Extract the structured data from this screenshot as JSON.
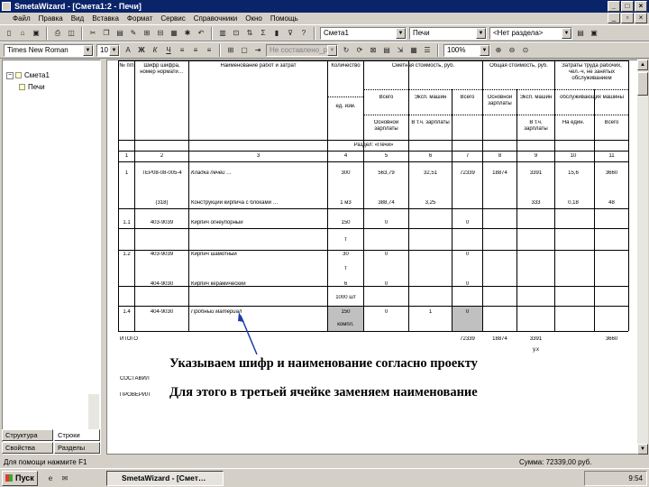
{
  "window": {
    "title": "SmetaWizard - [Смета1:2 - Печи]"
  },
  "menu": [
    "Файл",
    "Правка",
    "Вид",
    "Вставка",
    "Формат",
    "Сервис",
    "Справочники",
    "Окно",
    "Помощь"
  ],
  "toolbar1": {
    "estimate_combo": "Смета1",
    "section_combo": "Печи",
    "subsection_combo": "<Нет раздела>"
  },
  "toolbar2": {
    "font_combo": "Times New Roman",
    "size_combo": "10",
    "style_combo": "Не составлено_раз",
    "zoom_combo": "100%"
  },
  "tree": {
    "root": "Смета1",
    "child": "Печи"
  },
  "panel_tabs": [
    "Структура",
    "Строки",
    "Свойства",
    "Разделы"
  ],
  "table": {
    "header": [
      "№ п/п",
      "Шифр шифра, номер нормати…",
      "Наименование работ и затрат",
      "Количество",
      "Сметная стоимость, руб.",
      "Общая стоимость, руб.",
      "Затраты труда рабочих, чел.-ч, не занятых обслуживанием"
    ],
    "subheader": [
      "Всего",
      "Эксп. машин",
      "Всего",
      "Основной зарплаты",
      "Эксп. машин",
      "обслуживающих машины"
    ],
    "subheader2": [
      "ед. изм.",
      "Основной зарплаты",
      "В т.ч. зарплаты",
      "В т.ч. зарплаты",
      "На един.",
      "Всего"
    ],
    "section": "Раздел: «Печи»",
    "col_numbers": [
      "1",
      "2",
      "3",
      "4",
      "5",
      "6",
      "7",
      "8",
      "9",
      "10",
      "11"
    ],
    "rows": [
      {
        "n": "1",
        "code": "ТЕР08-08-005-4",
        "name": "Кладка печей …",
        "qty": "300",
        "c5": "563,79",
        "c6": "32,51",
        "c7": "72339",
        "c8": "18874",
        "c9": "3391",
        "c10": "15,6",
        "c11": "3660"
      },
      {
        "n": "",
        "code": "(318)",
        "name": "Конструкции кирпича с блоками …",
        "qty": "1 м3",
        "c5": "388,74",
        "c6": "3,25",
        "c7": "",
        "c8": "",
        "c9": "333",
        "c10": "0,18",
        "c11": "48"
      },
      {
        "n": "1.1",
        "code": "403-9039",
        "name": "Кирпич огнеупорный",
        "qty": "150",
        "unit": "т",
        "c5": "0",
        "c7": "0"
      },
      {
        "n": "1.2",
        "code": "403-9039",
        "name": "Кирпич шамотный",
        "qty": "30",
        "unit": "т",
        "c5": "0",
        "c7": "0"
      },
      {
        "n": "1.3",
        "code": "404-9030",
        "name": "Кирпич керамический",
        "qty": "6",
        "unit": "1000 шт",
        "c5": "0",
        "c7": "0"
      },
      {
        "n": "1.4",
        "code": "404-9030",
        "name": "Пробный материал",
        "qty": "150",
        "unit": "компл.",
        "c5": "0",
        "c6": "1",
        "c7": "0"
      }
    ],
    "total_label": "ИТОГО",
    "totals": [
      "72339",
      "18874",
      "3391",
      "3660"
    ],
    "total_sub": "у.х",
    "sign_labels": [
      "СОСТАВИЛ",
      "ПРОВЕРИЛ"
    ]
  },
  "annotation": {
    "line1": "Указываем шифр и наименование согласно проекту",
    "line2": "Для этого в третьей ячейке заменяем наименование"
  },
  "status": {
    "left": "Для помощи нажмите F1",
    "right": "Сумма: 72339,00 руб."
  },
  "taskbar": {
    "start": "Пуск",
    "app": "SmetaWizard - [Смет…",
    "clock": "9:54"
  }
}
